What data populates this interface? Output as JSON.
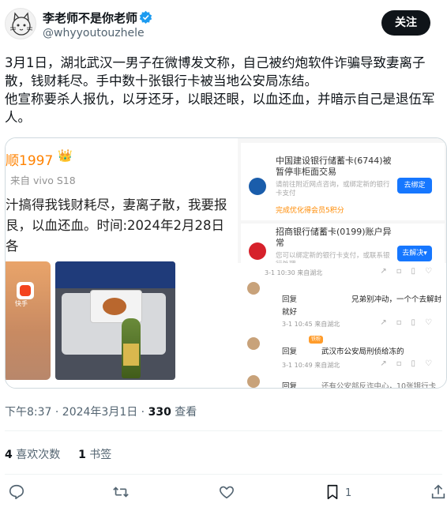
{
  "author": {
    "name": "李老师不是你老师",
    "handle": "@whyyoutouzhele",
    "verified": true,
    "avatar_icon": "cat-sketch-avatar"
  },
  "follow_label": "关注",
  "tweet": {
    "paragraph1": "3月1日，湖北武汉一男子在微博发文称，自己被约炮软件诈骗导致妻离子散，钱财耗尽。手中数十张银行卡被当地公安局冻结。",
    "paragraph2": "他宣称要杀人报仇，以牙还牙，以眼还眼，以血还血，并暗示自己是退伍军人。"
  },
  "media": {
    "weibo_post": {
      "username": "顺1997",
      "source": "来自 vivo S18",
      "line1": "汁搞得我钱财耗尽，妻离子散，我要报",
      "line2": "艮，以血还血。时间:2024年2月28日",
      "line3": "各",
      "app_badge_label": "快手"
    },
    "bank_cards": [
      {
        "title": "中国建设银行储蓄卡(6744)被暂停非柜面交易",
        "subtitle": "请前往附近网点咨询，或绑定新的银行卡支付",
        "button": "去绑定",
        "perk": "完成优化得会员5积分"
      },
      {
        "title": "招商银行储蓄卡(0199)账户异常",
        "subtitle": "您可以绑定新的银行卡支付，或联系银行处理",
        "button": "去解决▾"
      }
    ],
    "comments": {
      "meta1": "3-1 10:30  来自湖北",
      "reply1_label": "回复",
      "reply1_text": "兄弟别冲动，一个个去解封",
      "reply1_cont": "就好",
      "meta2": "3-1 10:45  来自湖北",
      "reply2_label": "回复",
      "reply2_text": "武汉市公安局刑侦给冻的",
      "meta3": "3-1 10:49  来自湖北",
      "reply3_label": "回复",
      "reply3_text": "还有公安部反诈中心，10张银行卡",
      "badge": "铁粉"
    }
  },
  "timestamp": {
    "time": "下午8:37 · 2024年3月1日 · ",
    "views_count": "330",
    "views_label": " 查看"
  },
  "stats": {
    "likes_count": "4",
    "likes_label": " 喜欢次数",
    "bookmarks_count": "1",
    "bookmarks_label": " 书签"
  },
  "actions": {
    "reply_icon": "reply-icon",
    "retweet_icon": "retweet-icon",
    "like_icon": "heart-icon",
    "bookmark_icon": "bookmark-icon",
    "bookmark_count": "1",
    "share_icon": "share-icon"
  },
  "colors": {
    "follow_bg": "#0f1419",
    "verified": "#1d9bf0",
    "secondary_text": "#536471",
    "weibo_orange": "#ff8200",
    "bank_button": "#1677ff"
  }
}
